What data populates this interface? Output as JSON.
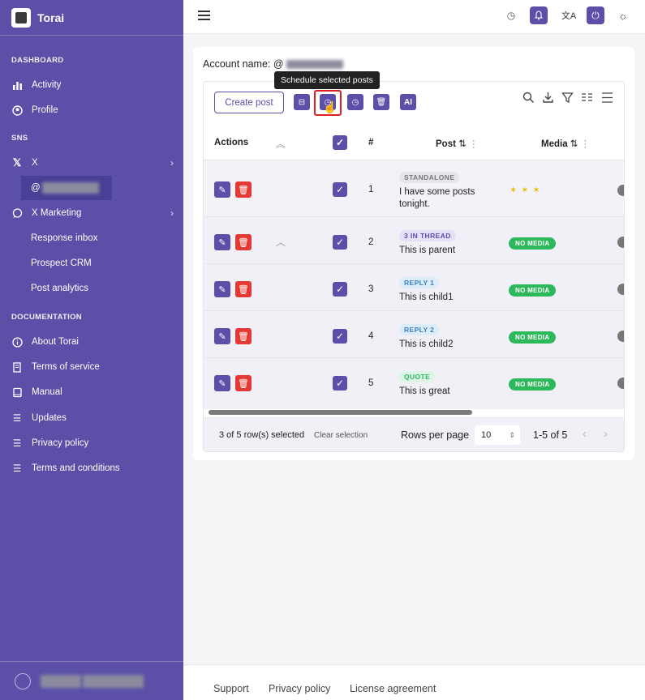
{
  "app": {
    "title": "Torai"
  },
  "sidebar": {
    "dashboard_title": "DASHBOARD",
    "dashboard_items": [
      {
        "label": "Activity",
        "icon": "chart-icon"
      },
      {
        "label": "Profile",
        "icon": "user-circle-icon"
      }
    ],
    "sns_title": "SNS",
    "x_label": "X",
    "x_account": "@",
    "x_marketing_label": "X Marketing",
    "x_marketing_sub": [
      "Response inbox",
      "Prospect CRM",
      "Post analytics"
    ],
    "docs_title": "DOCUMENTATION",
    "docs_items": [
      {
        "label": "About Torai",
        "icon": "info-icon"
      },
      {
        "label": "Terms of service",
        "icon": "document-icon"
      },
      {
        "label": "Manual",
        "icon": "book-icon"
      },
      {
        "label": "Updates",
        "icon": "list-icon"
      },
      {
        "label": "Privacy policy",
        "icon": "list-icon"
      },
      {
        "label": "Terms and conditions",
        "icon": "list-icon"
      }
    ]
  },
  "main": {
    "account_label": "Account name: @",
    "create_post": "Create post",
    "tooltip": "Schedule selected posts",
    "ai_label": "AI",
    "columns": {
      "actions": "Actions",
      "num": "#",
      "post": "Post",
      "media": "Media"
    },
    "rows": [
      {
        "num": "1",
        "tag": "STANDALONE",
        "tag_color": "#e6e6ea",
        "tag_text_color": "#777777",
        "post": "I have some posts tonight.",
        "media": "",
        "emoji": "✶✶✶"
      },
      {
        "num": "2",
        "tag": "3 IN THREAD",
        "tag_color": "#e4e0f7",
        "tag_text_color": "#5b4fa8",
        "post": "This is parent",
        "media": "NO MEDIA"
      },
      {
        "num": "3",
        "tag": "REPLY 1",
        "tag_color": "#dcecf9",
        "tag_text_color": "#3a7fc0",
        "post": "This is child1",
        "media": "NO MEDIA"
      },
      {
        "num": "4",
        "tag": "REPLY 2",
        "tag_color": "#dcecf9",
        "tag_text_color": "#3a7fc0",
        "post": "This is child2",
        "media": "NO MEDIA"
      },
      {
        "num": "5",
        "tag": "QUOTE",
        "tag_color": "#dcf5e6",
        "tag_text_color": "#2eb85c",
        "post": "This is great",
        "media": "NO MEDIA"
      }
    ],
    "selection_text": "3 of 5 row(s) selected",
    "clear_selection": "Clear selection",
    "rows_per_page_label": "Rows per page",
    "rows_per_page_value": "10",
    "pagination": "1-5 of 5"
  },
  "footer": {
    "support": "Support",
    "privacy": "Privacy policy",
    "license": "License agreement"
  },
  "colors": {
    "brand": "#5b4fa8",
    "danger": "#e53935",
    "success": "#2eb85c"
  }
}
